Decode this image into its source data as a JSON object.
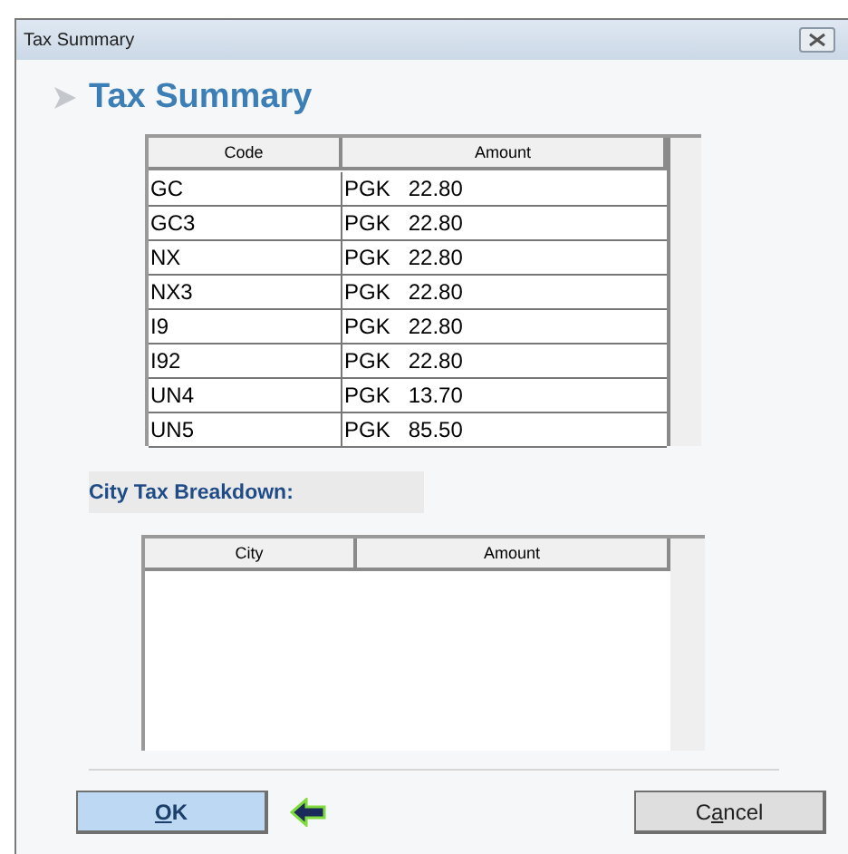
{
  "window": {
    "title": "Tax Summary"
  },
  "heading": "Tax Summary",
  "tax_table": {
    "columns": [
      "Code",
      "Amount"
    ],
    "rows": [
      {
        "code": "GC",
        "amount": "PGK   22.80"
      },
      {
        "code": "GC3",
        "amount": "PGK   22.80"
      },
      {
        "code": "NX",
        "amount": "PGK   22.80"
      },
      {
        "code": "NX3",
        "amount": "PGK   22.80"
      },
      {
        "code": "I9",
        "amount": "PGK   22.80"
      },
      {
        "code": "I92",
        "amount": "PGK   22.80"
      },
      {
        "code": "UN4",
        "amount": "PGK   13.70"
      },
      {
        "code": "UN5",
        "amount": "PGK   85.50"
      }
    ]
  },
  "city_section": {
    "label": "City Tax Breakdown:",
    "columns": [
      "City",
      "Amount"
    ]
  },
  "buttons": [
    {
      "kind": "default",
      "label_parts": [
        {
          "text": "O",
          "underlined": true
        },
        {
          "text": "K",
          "underlined": false
        }
      ]
    },
    {
      "kind": "normal",
      "label_parts": [
        {
          "text": "C",
          "underlined": false
        },
        {
          "text": "a",
          "underlined": true
        },
        {
          "text": "ncel",
          "underlined": false
        }
      ]
    }
  ]
}
